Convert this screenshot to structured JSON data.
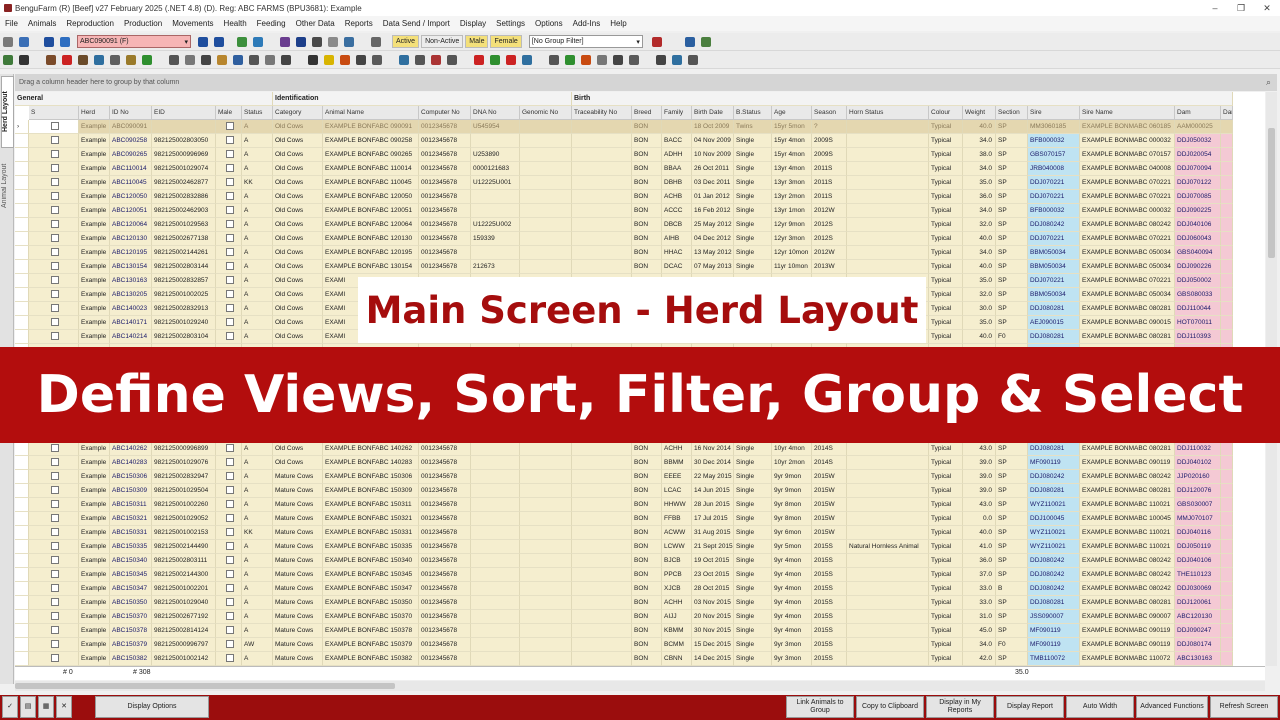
{
  "window": {
    "title": "BenguFarm (R) [Beef] v27 February 2025 (.NET 4.8) (D). Reg: ABC FARMS (BPU3681): Example",
    "controls": [
      "–",
      "❐",
      "✕"
    ]
  },
  "menu": [
    "File",
    "Animals",
    "Reproduction",
    "Production",
    "Movements",
    "Health",
    "Feeding",
    "Other Data",
    "Reports",
    "Data Send / Import",
    "Display",
    "Settings",
    "Options",
    "Add-Ins",
    "Help"
  ],
  "toolbar": {
    "animal_select": "ABC090091 (F)",
    "filters": {
      "active": "Active",
      "non_active": "Non-Active",
      "male": "Male",
      "female": "Female"
    },
    "group_filter": "[No Group Filter]"
  },
  "side_tabs": {
    "herd": "Herd Layout",
    "animal": "Animal Layout"
  },
  "group_area": "Drag a column header here to group by that column",
  "grid": {
    "bands": [
      {
        "label": "General"
      },
      {
        "label": "Identification"
      },
      {
        "label": "Birth"
      }
    ],
    "columns": [
      "S",
      "Herd",
      "ID No",
      "EID",
      "Male",
      "Status",
      "Category",
      "Animal Name",
      "Computer No",
      "DNA No",
      "Genomic No",
      "Traceability No",
      "Breed",
      "Family",
      "Birth Date",
      "B.Status",
      "Age",
      "Season",
      "Horn Status",
      "Colour",
      "Weight",
      "Section",
      "Sire",
      "Sire Name",
      "Dam",
      "Dam"
    ],
    "rows": [
      [
        "Example",
        "ABC090091",
        "",
        "",
        "A",
        "Old Cows",
        "EXAMPLE BONFABC 090091",
        "0012345678",
        "U545954",
        "",
        "",
        "BON",
        "",
        "18 Oct 2009",
        "Twins",
        "15yr 5mon",
        "?",
        "",
        "Typical",
        "40.0",
        "SP",
        "MM3060185",
        "EXAMPLE BONMABC 060185",
        "AAM000025"
      ],
      [
        "Example",
        "ABC090258",
        "982125002803050",
        "",
        "A",
        "Old Cows",
        "EXAMPLE BONFABC 090258",
        "0012345678",
        "",
        "",
        "",
        "BON",
        "BACC",
        "04 Nov 2009",
        "Single",
        "15yr 4mon",
        "2009S",
        "",
        "Typical",
        "34.0",
        "SP",
        "BFB000032",
        "EXAMPLE BONMABC 000032",
        "DDJ050032"
      ],
      [
        "Example",
        "ABC090265",
        "982125000996969",
        "",
        "A",
        "Old Cows",
        "EXAMPLE BONFABC 090265",
        "0012345678",
        "U253890",
        "",
        "",
        "BON",
        "ADHH",
        "10 Nov 2009",
        "Single",
        "15yr 4mon",
        "2009S",
        "",
        "Typical",
        "38.0",
        "SP",
        "GBS070157",
        "EXAMPLE BONMABC 070157",
        "DDJ020054"
      ],
      [
        "Example",
        "ABC110014",
        "982125001029074",
        "",
        "A",
        "Old Cows",
        "EXAMPLE BONFABC 110014",
        "0012345678",
        "0000121683",
        "",
        "",
        "BON",
        "BBAA",
        "26 Oct 2011",
        "Single",
        "13yr 4mon",
        "2011S",
        "",
        "Typical",
        "34.0",
        "SP",
        "JRB040008",
        "EXAMPLE BONMABC 040008",
        "DDJ070094"
      ],
      [
        "Example",
        "ABC110045",
        "982125002462877",
        "",
        "KK",
        "Old Cows",
        "EXAMPLE BONFABC 110045",
        "0012345678",
        "U12225U001",
        "",
        "",
        "BON",
        "DBHB",
        "03 Dec 2011",
        "Single",
        "13yr 3mon",
        "2011S",
        "",
        "Typical",
        "35.0",
        "SP",
        "DDJ070221",
        "EXAMPLE BONMABC 070221",
        "DDJ070122"
      ],
      [
        "Example",
        "ABC120050",
        "982125002832886",
        "",
        "A",
        "Old Cows",
        "EXAMPLE BONFABC 120050",
        "0012345678",
        "",
        "",
        "",
        "BON",
        "ACHB",
        "01 Jan 2012",
        "Single",
        "13yr 2mon",
        "2011S",
        "",
        "Typical",
        "36.0",
        "SP",
        "DDJ070221",
        "EXAMPLE BONMABC 070221",
        "DDJ070085"
      ],
      [
        "Example",
        "ABC120051",
        "982125002462903",
        "",
        "A",
        "Old Cows",
        "EXAMPLE BONFABC 120051",
        "0012345678",
        "",
        "",
        "",
        "BON",
        "ACCC",
        "16 Feb 2012",
        "Single",
        "13yr 1mon",
        "2012W",
        "",
        "Typical",
        "34.0",
        "SP",
        "BFB000032",
        "EXAMPLE BONMABC 000032",
        "DDJ090225"
      ],
      [
        "Example",
        "ABC120064",
        "982125001029563",
        "",
        "A",
        "Old Cows",
        "EXAMPLE BONFABC 120064",
        "0012345678",
        "U12225U002",
        "",
        "",
        "BON",
        "DBCB",
        "25 May 2012",
        "Single",
        "12yr 9mon",
        "2012S",
        "",
        "Typical",
        "32.0",
        "SP",
        "DDJ080242",
        "EXAMPLE BONMABC 080242",
        "DDJ040106"
      ],
      [
        "Example",
        "ABC120130",
        "982125002677138",
        "",
        "A",
        "Old Cows",
        "EXAMPLE BONFABC 120130",
        "0012345678",
        "159339",
        "",
        "",
        "BON",
        "AIHB",
        "04 Dec 2012",
        "Single",
        "12yr 3mon",
        "2012S",
        "",
        "Typical",
        "40.0",
        "SP",
        "DDJ070221",
        "EXAMPLE BONMABC 070221",
        "DDJ060043"
      ],
      [
        "Example",
        "ABC120195",
        "982125002144261",
        "",
        "A",
        "Old Cows",
        "EXAMPLE BONFABC 120195",
        "0012345678",
        "",
        "",
        "",
        "BON",
        "HHAC",
        "13 May 2012",
        "Single",
        "12yr 10mon",
        "2012W",
        "",
        "Typical",
        "34.0",
        "SP",
        "BBM050034",
        "EXAMPLE BONMABC 050034",
        "GBS040094"
      ],
      [
        "Example",
        "ABC130154",
        "982125002803144",
        "",
        "A",
        "Old Cows",
        "EXAMPLE BONFABC 130154",
        "0012345678",
        "212673",
        "",
        "",
        "BON",
        "DCAC",
        "07 May 2013",
        "Single",
        "11yr 10mon",
        "2013W",
        "",
        "Typical",
        "40.0",
        "SP",
        "BBM050034",
        "EXAMPLE BONMABC 050034",
        "DDJ090226"
      ],
      [
        "Example",
        "ABC130163",
        "982125002832857",
        "",
        "A",
        "Old Cows",
        "EXAMI",
        "",
        "",
        "",
        "",
        "",
        "",
        "",
        "",
        "",
        "",
        "",
        "Typical",
        "35.0",
        "SP",
        "DDJ070221",
        "EXAMPLE BONMABC 070221",
        "DDJ050002"
      ],
      [
        "Example",
        "ABC130205",
        "982125001002025",
        "",
        "A",
        "Old Cows",
        "EXAMI",
        "",
        "",
        "",
        "",
        "",
        "",
        "",
        "",
        "",
        "",
        "",
        "Typical",
        "32.0",
        "SP",
        "BBM050034",
        "EXAMPLE BONMABC 050034",
        "GBS080033"
      ],
      [
        "Example",
        "ABC140023",
        "982125002832913",
        "",
        "A",
        "Old Cows",
        "EXAMI",
        "",
        "",
        "",
        "",
        "",
        "",
        "",
        "",
        "",
        "",
        "",
        "Typical",
        "30.0",
        "SP",
        "DDJ080281",
        "EXAMPLE BONMABC 080281",
        "DDJ110044"
      ],
      [
        "Example",
        "ABC140171",
        "982125001029240",
        "",
        "A",
        "Old Cows",
        "EXAMI",
        "",
        "",
        "",
        "",
        "",
        "",
        "",
        "",
        "",
        "",
        "",
        "Typical",
        "35.0",
        "SP",
        "AEJ090015",
        "EXAMPLE BONMABC 090015",
        "HOT070011"
      ],
      [
        "Example",
        "ABC140214",
        "982125002803104",
        "",
        "A",
        "Old Cows",
        "EXAMI",
        "",
        "",
        "",
        "",
        "",
        "",
        "",
        "",
        "",
        "",
        "",
        "Typical",
        "40.0",
        "F0",
        "DDJ080281",
        "EXAMPLE BONMABC 080281",
        "DDJ110393"
      ],
      [
        "",
        "",
        "",
        "",
        "",
        "",
        "",
        "",
        "",
        "",
        "",
        "",
        "",
        "",
        "",
        "",
        "",
        "",
        "",
        "",
        "",
        "",
        "",
        ""
      ],
      [
        "",
        "",
        "",
        "",
        "",
        "",
        "",
        "",
        "",
        "",
        "",
        "",
        "",
        "",
        "",
        "",
        "",
        "",
        "",
        "",
        "",
        "",
        "",
        ""
      ],
      [
        "",
        "",
        "",
        "",
        "",
        "",
        "",
        "",
        "",
        "",
        "",
        "",
        "",
        "",
        "",
        "",
        "",
        "",
        "",
        "",
        "",
        "",
        "",
        ""
      ],
      [
        "",
        "",
        "",
        "",
        "",
        "",
        "",
        "",
        "",
        "",
        "",
        "",
        "",
        "",
        "",
        "",
        "",
        "",
        "",
        "",
        "",
        "",
        "",
        ""
      ],
      [
        "",
        "",
        "",
        "",
        "",
        "",
        "",
        "",
        "",
        "",
        "",
        "",
        "",
        "",
        "",
        "",
        "",
        "",
        "",
        "",
        "",
        "",
        "",
        ""
      ],
      [
        "",
        "",
        "",
        "",
        "",
        "",
        "",
        "",
        "",
        "",
        "",
        "",
        "",
        "",
        "",
        "",
        "",
        "",
        "",
        "",
        "",
        "",
        "",
        ""
      ],
      [
        "",
        "",
        "",
        "",
        "",
        "",
        "",
        "",
        "",
        "",
        "",
        "",
        "",
        "",
        "",
        "",
        "",
        "",
        "",
        "",
        "",
        "",
        "",
        ""
      ],
      [
        "Example",
        "ABC140262",
        "982125000996899",
        "",
        "A",
        "Old Cows",
        "EXAMPLE BONFABC 140262",
        "0012345678",
        "",
        "",
        "",
        "BON",
        "ACHH",
        "16 Nov 2014",
        "Single",
        "10yr 4mon",
        "2014S",
        "",
        "Typical",
        "43.0",
        "SP",
        "DDJ080281",
        "EXAMPLE BONMABC 080281",
        "DDJ110032"
      ],
      [
        "Example",
        "ABC140283",
        "982125001029076",
        "",
        "A",
        "Old Cows",
        "EXAMPLE BONFABC 140283",
        "0012345678",
        "",
        "",
        "",
        "BON",
        "BBMM",
        "30 Dec 2014",
        "Single",
        "10yr 2mon",
        "2014S",
        "",
        "Typical",
        "39.0",
        "SP",
        "MF090119",
        "EXAMPLE BONMABC 090119",
        "DDJ040102"
      ],
      [
        "Example",
        "ABC150306",
        "982125002832947",
        "",
        "A",
        "Mature Cows",
        "EXAMPLE BONFABC 150306",
        "0012345678",
        "",
        "",
        "",
        "BON",
        "EEEE",
        "22 May 2015",
        "Single",
        "9yr 9mon",
        "2015W",
        "",
        "Typical",
        "39.0",
        "SP",
        "DDJ080242",
        "EXAMPLE BONMABC 080242",
        "JJP020160"
      ],
      [
        "Example",
        "ABC150309",
        "982125001029504",
        "",
        "A",
        "Mature Cows",
        "EXAMPLE BONFABC 150309",
        "0012345678",
        "",
        "",
        "",
        "BON",
        "LCAC",
        "14 Jun 2015",
        "Single",
        "9yr 9mon",
        "2015W",
        "",
        "Typical",
        "39.0",
        "SP",
        "DDJ080281",
        "EXAMPLE BONMABC 080281",
        "DDJ120076"
      ],
      [
        "Example",
        "ABC150311",
        "982125001002260",
        "",
        "A",
        "Mature Cows",
        "EXAMPLE BONFABC 150311",
        "0012345678",
        "",
        "",
        "",
        "BON",
        "HHWW",
        "28 Jun 2015",
        "Single",
        "9yr 8mon",
        "2015W",
        "",
        "Typical",
        "43.0",
        "SP",
        "WYZ110021",
        "EXAMPLE BONMABC 110021",
        "GBS030007"
      ],
      [
        "Example",
        "ABC150321",
        "982125001029052",
        "",
        "A",
        "Mature Cows",
        "EXAMPLE BONFABC 150321",
        "0012345678",
        "",
        "",
        "",
        "BON",
        "FFBB",
        "17 Jul 2015",
        "Single",
        "9yr 8mon",
        "2015W",
        "",
        "Typical",
        "0.0",
        "SP",
        "DDJ100045",
        "EXAMPLE BONMABC 100045",
        "MMJ070107"
      ],
      [
        "Example",
        "ABC150331",
        "982125001002153",
        "",
        "KK",
        "Mature Cows",
        "EXAMPLE BONFABC 150331",
        "0012345678",
        "",
        "",
        "",
        "BON",
        "ACWW",
        "31 Aug 2015",
        "Single",
        "9yr 6mon",
        "2015W",
        "",
        "Typical",
        "40.0",
        "SP",
        "WYZ110021",
        "EXAMPLE BONMABC 110021",
        "DDJ040116"
      ],
      [
        "Example",
        "ABC150335",
        "982125002144490",
        "",
        "A",
        "Mature Cows",
        "EXAMPLE BONFABC 150335",
        "0012345678",
        "",
        "",
        "",
        "BON",
        "LCWW",
        "21 Sept 2015",
        "Single",
        "9yr 5mon",
        "2015S",
        "Natural Hornless Animal",
        "Typical",
        "41.0",
        "SP",
        "WYZ110021",
        "EXAMPLE BONMABC 110021",
        "DDJ050119"
      ],
      [
        "Example",
        "ABC150340",
        "982125002803111",
        "",
        "A",
        "Mature Cows",
        "EXAMPLE BONFABC 150340",
        "0012345678",
        "",
        "",
        "",
        "BON",
        "BJCB",
        "19 Oct 2015",
        "Single",
        "9yr 4mon",
        "2015S",
        "",
        "Typical",
        "36.0",
        "SP",
        "DDJ080242",
        "EXAMPLE BONMABC 080242",
        "DDJ040106"
      ],
      [
        "Example",
        "ABC150345",
        "982125002144300",
        "",
        "A",
        "Mature Cows",
        "EXAMPLE BONFABC 150345",
        "0012345678",
        "",
        "",
        "",
        "BON",
        "PPCB",
        "23 Oct 2015",
        "Single",
        "9yr 4mon",
        "2015S",
        "",
        "Typical",
        "37.0",
        "SP",
        "DDJ080242",
        "EXAMPLE BONMABC 080242",
        "THE110123"
      ],
      [
        "Example",
        "ABC150347",
        "982125001002201",
        "",
        "A",
        "Mature Cows",
        "EXAMPLE BONFABC 150347",
        "0012345678",
        "",
        "",
        "",
        "BON",
        "XJCB",
        "28 Oct 2015",
        "Single",
        "9yr 4mon",
        "2015S",
        "",
        "Typical",
        "33.0",
        "B",
        "DDJ080242",
        "EXAMPLE BONMABC 080242",
        "DDJ030069"
      ],
      [
        "Example",
        "ABC150350",
        "982125001029040",
        "",
        "A",
        "Mature Cows",
        "EXAMPLE BONFABC 150350",
        "0012345678",
        "",
        "",
        "",
        "BON",
        "ACHH",
        "03 Nov 2015",
        "Single",
        "9yr 4mon",
        "2015S",
        "",
        "Typical",
        "33.0",
        "SP",
        "DDJ080281",
        "EXAMPLE BONMABC 080281",
        "DDJ120061"
      ],
      [
        "Example",
        "ABC150370",
        "982125002677192",
        "",
        "A",
        "Mature Cows",
        "EXAMPLE BONFABC 150370",
        "0012345678",
        "",
        "",
        "",
        "BON",
        "AIJJ",
        "20 Nov 2015",
        "Single",
        "9yr 4mon",
        "2015S",
        "",
        "Typical",
        "31.0",
        "SP",
        "JSS090007",
        "EXAMPLE BONMABC 090007",
        "ABC120130"
      ],
      [
        "Example",
        "ABC150378",
        "982125002814124",
        "",
        "A",
        "Mature Cows",
        "EXAMPLE BONFABC 150378",
        "0012345678",
        "",
        "",
        "",
        "BON",
        "KBMM",
        "30 Nov 2015",
        "Single",
        "9yr 4mon",
        "2015S",
        "",
        "Typical",
        "45.0",
        "SP",
        "MF090119",
        "EXAMPLE BONMABC 090119",
        "DDJ090247"
      ],
      [
        "Example",
        "ABC150379",
        "982125000996797",
        "",
        "AW",
        "Mature Cows",
        "EXAMPLE BONFABC 150379",
        "0012345678",
        "",
        "",
        "",
        "BON",
        "BCMM",
        "15 Dec 2015",
        "Single",
        "9yr 3mon",
        "2015S",
        "",
        "Typical",
        "34.0",
        "F0",
        "MF090119",
        "EXAMPLE BONMABC 090119",
        "DDJ080174"
      ],
      [
        "Example",
        "ABC150382",
        "982125001002142",
        "",
        "A",
        "Mature Cows",
        "EXAMPLE BONFABC 150382",
        "0012345678",
        "",
        "",
        "",
        "BON",
        "CBNN",
        "14 Dec 2015",
        "Single",
        "9yr 3mon",
        "2015S",
        "",
        "Typical",
        "42.0",
        "SP",
        "TMB110072",
        "EXAMPLE BONMABC 110072",
        "ABC130163"
      ]
    ]
  },
  "footer": {
    "count_a": "# 0",
    "count_b": "# 308",
    "weight_sum": "35.0"
  },
  "bottom_buttons": {
    "display_options": "Display Options",
    "link_animals": "Link Animals to Group",
    "copy_clipboard": "Copy to Clipboard",
    "display_my_reports": "Display in My Reports",
    "display_report": "Display Report",
    "auto_width": "Auto Width",
    "advanced_functions": "Advanced Functions",
    "refresh_screen": "Refresh Screen"
  },
  "overlay": {
    "subtitle": "Main Screen - Herd Layout",
    "headline": "Define Views, Sort, Filter, Group & Select"
  },
  "colors": {
    "accent_red": "#b30d0d",
    "row_bg": "#f5eecf",
    "sire_bg": "#bfe3f2",
    "dam_bg": "#f4c9d4",
    "selected_animal_bg": "#f6b5b5"
  }
}
